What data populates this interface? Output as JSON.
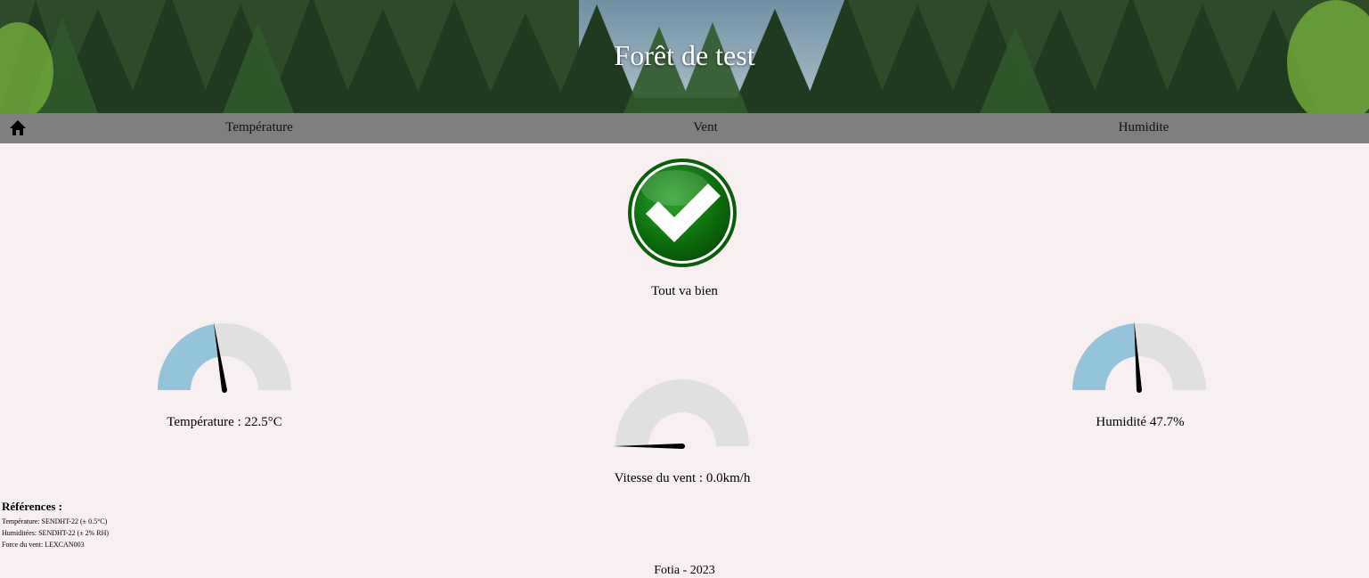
{
  "header": {
    "title": "Forêt de test"
  },
  "nav": {
    "home_icon": "home-icon",
    "items": [
      {
        "label": "Température"
      },
      {
        "label": "Vent"
      },
      {
        "label": "Humidite"
      }
    ]
  },
  "status": {
    "icon": "check-circle-icon",
    "text": "Tout va bien",
    "color": "#1a7a1a"
  },
  "gauges": {
    "temperature": {
      "label": "Température : 22.5°C",
      "level": 0.45
    },
    "wind": {
      "label": "Vitesse du vent : 0.0km/h",
      "level": 0.0
    },
    "humidity": {
      "label": "Humidité 47.7%",
      "level": 0.477
    }
  },
  "references": {
    "title": "Références :",
    "lines": [
      "Température: SENDHT-22 (± 0.5°C)",
      "Humiditées: SENDHT-22 (± 2% RH)",
      "Force du vent: LEXCAN003"
    ]
  },
  "footer": {
    "text": "Fotia - 2023"
  },
  "colors": {
    "gauge_fill": "#93c4dc",
    "gauge_bg": "#e0e0e0",
    "nav_bg": "#7f7f7f",
    "page_bg": "#f7eff0"
  }
}
